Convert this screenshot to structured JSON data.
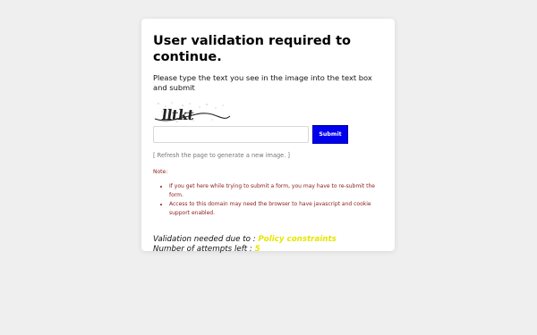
{
  "dialog": {
    "title": "User validation required to continue.",
    "instructions": "Please type the text you see in the image into the text box and submit",
    "captcha_text": "lltkt",
    "input": {
      "value": "",
      "placeholder": ""
    },
    "submit_label": "Submit",
    "refresh_note": "[ Refresh the page to generate a new image. ]",
    "note_label": "Note:",
    "notes": [
      "If you get here while trying to submit a form, you may have to re-submit the form.",
      "Access to this domain may need the browser to have javascript and cookie support enabled."
    ],
    "reason_label": "Validation needed due to :",
    "reason_value": "Policy constraints",
    "attempts_label": "Number of attempts left :",
    "attempts_value": "5"
  },
  "colors": {
    "page_background": "#efefef",
    "card_background": "#ffffff",
    "submit_button": "#0000ee",
    "note_text": "#8b1a1a",
    "highlight": "#e6e600"
  },
  "icons": {
    "captcha": "captcha-image"
  }
}
